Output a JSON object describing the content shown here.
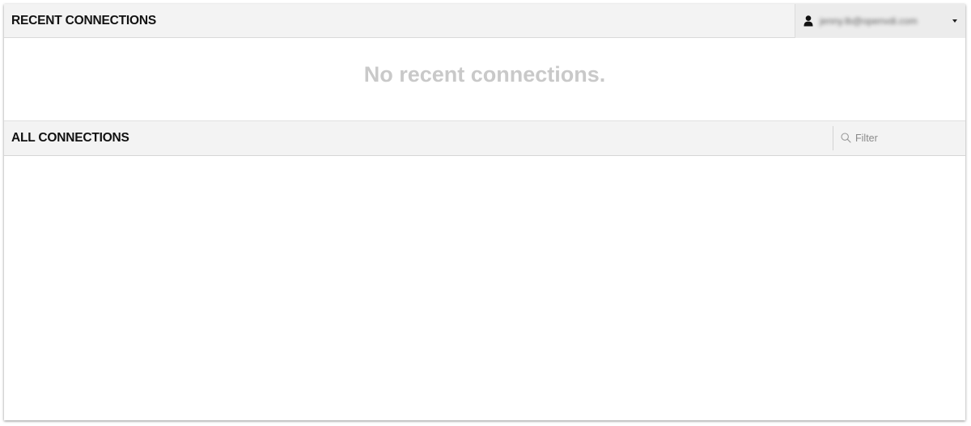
{
  "recent": {
    "title": "RECENT CONNECTIONS",
    "empty_message": "No recent connections."
  },
  "user_menu": {
    "username": "jenny.lb@openvdi.com",
    "icon": "user-icon",
    "caret_icon": "caret-down-icon"
  },
  "all": {
    "title": "ALL CONNECTIONS",
    "filter_placeholder": "Filter",
    "filter_value": "",
    "search_icon": "search-icon"
  },
  "colors": {
    "header_bg": "#f3f3f3",
    "empty_text": "#c9c9c9",
    "title_text": "#111111"
  }
}
